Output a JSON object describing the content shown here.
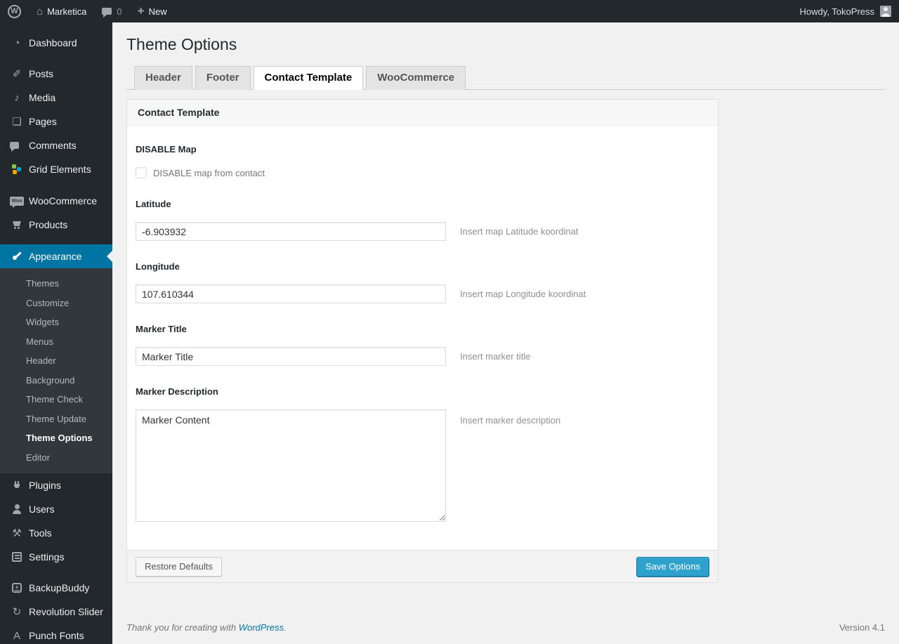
{
  "admin_bar": {
    "site_name": "Marketica",
    "comment_count": "0",
    "new_label": "New",
    "howdy": "Howdy, TokoPress",
    "wp_logo": "W"
  },
  "sidebar": {
    "dashboard": "Dashboard",
    "posts": "Posts",
    "media": "Media",
    "pages": "Pages",
    "comments": "Comments",
    "grid_elements": "Grid Elements",
    "woocommerce": "WooCommerce",
    "woo_badge": "Woo",
    "products": "Products",
    "appearance": "Appearance",
    "appearance_submenu": [
      "Themes",
      "Customize",
      "Widgets",
      "Menus",
      "Header",
      "Background",
      "Theme Check",
      "Theme Update",
      "Theme Options",
      "Editor"
    ],
    "plugins": "Plugins",
    "users": "Users",
    "tools": "Tools",
    "settings": "Settings",
    "backupbuddy": "BackupBuddy",
    "revolution_slider": "Revolution Slider",
    "punch_fonts": "Punch Fonts",
    "punch_fonts_icon": "A"
  },
  "page": {
    "title": "Theme Options",
    "tabs": [
      {
        "label": "Header"
      },
      {
        "label": "Footer"
      },
      {
        "label": "Contact Template"
      },
      {
        "label": "WooCommerce"
      }
    ]
  },
  "panel": {
    "header": "Contact Template",
    "fields": {
      "disable_map": {
        "label": "DISABLE Map",
        "checkbox_label": "DISABLE map from contact",
        "checked": false
      },
      "latitude": {
        "label": "Latitude",
        "value": "-6.903932",
        "description": "Insert map Latitude koordinat"
      },
      "longitude": {
        "label": "Longitude",
        "value": "107.610344",
        "description": "Insert map Longitude koordinat"
      },
      "marker_title": {
        "label": "Marker Title",
        "value": "Marker Title",
        "description": "Insert marker title"
      },
      "marker_description": {
        "label": "Marker Description",
        "value": "Marker Content",
        "description": "Insert marker description"
      }
    },
    "footer": {
      "restore_label": "Restore Defaults",
      "save_label": "Save Options"
    }
  },
  "footer": {
    "thanks_prefix": "Thank you for creating with ",
    "wordpress_link": "WordPress",
    "thanks_suffix": ".",
    "version": "Version 4.1"
  },
  "colors": {
    "accent_blue": "#0074a2",
    "button_blue": "#2ea2cc",
    "admin_bar_bg": "#23282d",
    "submenu_bg": "#32373c",
    "page_bg": "#f1f1f1"
  },
  "icons": {
    "dashboard": "◔",
    "posts": "✐",
    "media": "♪",
    "pages": "❏",
    "home": "⌂",
    "plus": "+",
    "tools": "⚒",
    "refresh": "↻"
  }
}
